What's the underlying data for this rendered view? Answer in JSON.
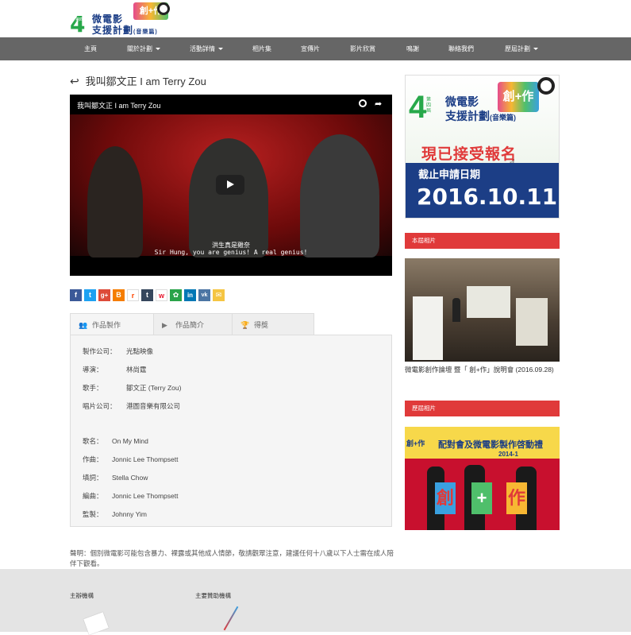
{
  "header": {
    "logo": {
      "edition_num": "4",
      "edition_label": "第四屆",
      "line1": "微電影",
      "line2": "支援計劃",
      "line2_suffix": "(音樂篇)",
      "badge": "創+作"
    }
  },
  "nav": {
    "items": [
      {
        "label": "主頁",
        "dropdown": false
      },
      {
        "label": "關於計劃",
        "dropdown": true
      },
      {
        "label": "活動詳情",
        "dropdown": true
      },
      {
        "label": "相片集",
        "dropdown": false
      },
      {
        "label": "宣傳片",
        "dropdown": false
      },
      {
        "label": "影片欣賞",
        "dropdown": false
      },
      {
        "label": "鳴謝",
        "dropdown": false
      },
      {
        "label": "聯絡我們",
        "dropdown": false
      },
      {
        "label": "歷屆計劃",
        "dropdown": true
      }
    ]
  },
  "page": {
    "back_icon": "reply-arrow-icon",
    "title": "我叫鄒文正 I am Terry Zou"
  },
  "video": {
    "title": "我叫鄒文正 I am Terry Zou",
    "subtitle_cn": "洪生真是雞奈",
    "subtitle_en": "Sir Hung, you are genius! A real genius!",
    "icons": [
      "clock-icon",
      "share-icon",
      "play-icon"
    ]
  },
  "share_buttons": [
    {
      "name": "facebook",
      "glyph": "f",
      "color": "#3b5998"
    },
    {
      "name": "twitter",
      "glyph": "t",
      "color": "#1da1f2"
    },
    {
      "name": "google-plus",
      "glyph": "g+",
      "color": "#dd4b39"
    },
    {
      "name": "blogger",
      "glyph": "B",
      "color": "#f57d00"
    },
    {
      "name": "reddit",
      "glyph": "r",
      "color": "#ffffff"
    },
    {
      "name": "tumblr",
      "glyph": "t",
      "color": "#35465c"
    },
    {
      "name": "weibo",
      "glyph": "w",
      "color": "#ffffff"
    },
    {
      "name": "renren",
      "glyph": "✿",
      "color": "#2aa34a"
    },
    {
      "name": "linkedin",
      "glyph": "in",
      "color": "#0077b5"
    },
    {
      "name": "vk",
      "glyph": "vk",
      "color": "#4c75a3"
    },
    {
      "name": "email",
      "glyph": "✉",
      "color": "#f5c542"
    }
  ],
  "tabs": [
    {
      "label": "作品製作",
      "icon": "users-icon",
      "active": true
    },
    {
      "label": "作品簡介",
      "icon": "video-icon",
      "active": false
    },
    {
      "label": "得獎",
      "icon": "trophy-icon",
      "active": false
    }
  ],
  "credits": [
    {
      "label": "製作公司：",
      "value": "光點映像"
    },
    {
      "label": "導演：",
      "value": "林尚霆"
    },
    {
      "label": "歌手：",
      "value": "鄒文正 (Terry Zou)"
    },
    {
      "label": "唱片公司：",
      "value": "港圖音樂有限公司"
    }
  ],
  "song": [
    {
      "label": "歌名：",
      "value": "On My Mind"
    },
    {
      "label": "作曲：",
      "value": "Jonnic Lee Thompsett"
    },
    {
      "label": "填詞：",
      "value": "Stella Chow"
    },
    {
      "label": "編曲：",
      "value": "Jonnic Lee Thompsett"
    },
    {
      "label": "監製：",
      "value": "Johnny Yim"
    }
  ],
  "disclaimer": "聲明：個別微電影可能包含暴力、裸露或其他成人情節，敬請觀眾注意，建議任何十八歲以下人士需在成人陪伴下觀看。",
  "sidebar": {
    "ad": {
      "num": "4",
      "edition": "第四屆",
      "line1": "微電影",
      "line2": "支援計劃",
      "suffix": "(音樂篇)",
      "badge": "創+作",
      "cta": "現已接受報名",
      "deadline_label": "截止申請日期",
      "deadline": "2016.10.11"
    },
    "section1_title": "本屆相片",
    "photo1_caption": "微電影創作論壇 暨「 創+作」說明會 (2016.09.28)",
    "section2_title": "歷屆相片",
    "photo2_banner": "配對會及微電影製作啓動禮",
    "photo2_year": "2014-1",
    "photo2_sign1": "創",
    "photo2_sign2": "+",
    "photo2_sign3": "作",
    "photo2_side": "創+作"
  },
  "footer": {
    "organizer_label": "主辦機構",
    "sponsor_label": "主要贊助機構"
  }
}
